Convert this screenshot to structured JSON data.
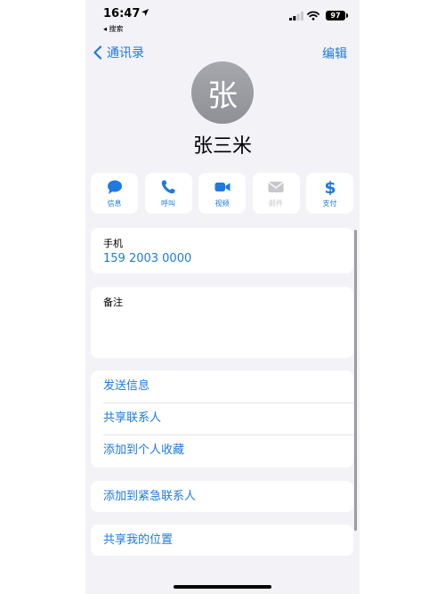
{
  "status_bar": {
    "time": "16:47",
    "back_app": "◂ 搜索",
    "battery": "97"
  },
  "nav": {
    "back_label": "通讯录",
    "edit_label": "编辑"
  },
  "contact": {
    "avatar_initial": "张",
    "name": "张三米"
  },
  "actions": [
    {
      "label": "信息",
      "icon": "message-icon"
    },
    {
      "label": "呼叫",
      "icon": "phone-icon"
    },
    {
      "label": "视频",
      "icon": "video-icon"
    },
    {
      "label": "邮件",
      "icon": "mail-icon"
    },
    {
      "label": "支付",
      "icon": "dollar-icon"
    }
  ],
  "phone_card": {
    "label": "手机",
    "number": "159 2003 0000"
  },
  "notes_card": {
    "label": "备注"
  },
  "list_items": [
    "发送信息",
    "共享联系人",
    "添加到个人收藏"
  ],
  "emergency": "添加到紧急联系人",
  "share_location": "共享我的位置",
  "colors": {
    "accent": "#1f7ae0",
    "background": "#f2f2f7",
    "disabled": "#c7c7cc"
  }
}
